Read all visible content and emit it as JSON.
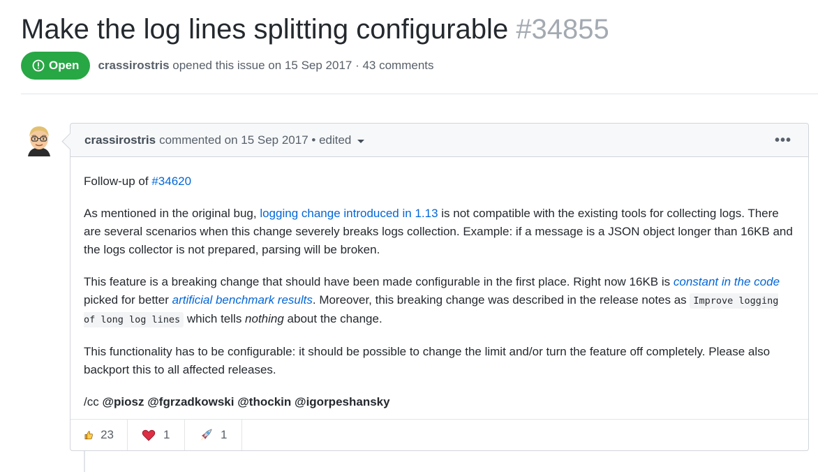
{
  "issue": {
    "title": "Make the log lines splitting configurable",
    "number": "#34855",
    "state": "Open",
    "author": "crassirostris",
    "opened_text": "opened this issue on 15 Sep 2017 · 43 comments"
  },
  "comment": {
    "author": "crassirostris",
    "meta": "commented on 15 Sep 2017 • edited",
    "menu_icon": "kebab-horizontal-icon",
    "p1_prefix": "Follow-up of ",
    "p1_link": "#34620",
    "p2_prefix": "As mentioned in the original bug, ",
    "p2_link": "logging change introduced in 1.13",
    "p2_rest": " is not compatible with the existing tools for collecting logs. There are several scenarios when this change severely breaks logs collection. Example: if a message is a JSON object longer than 16KB and the logs collector is not prepared, parsing will be broken.",
    "p3_a": "This feature is a breaking change that should have been made configurable in the first place. Right now 16KB is ",
    "p3_link1": "constant in the code",
    "p3_b": " picked for better ",
    "p3_link2": "artificial benchmark results",
    "p3_c": ". Moreover, this breaking change was described in the release notes as ",
    "p3_code": "Improve logging of long log lines",
    "p3_d": " which tells ",
    "p3_em": "nothing",
    "p3_e": " about the change.",
    "p4": "This functionality has to be configurable: it should be possible to change the limit and/or turn the feature off completely. Please also backport this to all affected releases.",
    "cc_prefix": "/cc ",
    "mentions": [
      "@piosz",
      "@fgrzadkowski",
      "@thockin",
      "@igorpeshansky"
    ]
  },
  "reactions": [
    {
      "icon": "thumbs-up-icon",
      "count": "23"
    },
    {
      "icon": "heart-icon",
      "count": "1"
    },
    {
      "icon": "rocket-icon",
      "count": "1"
    }
  ],
  "colors": {
    "open_green": "#28a745",
    "link_blue": "#0366d6",
    "muted": "#586069"
  }
}
